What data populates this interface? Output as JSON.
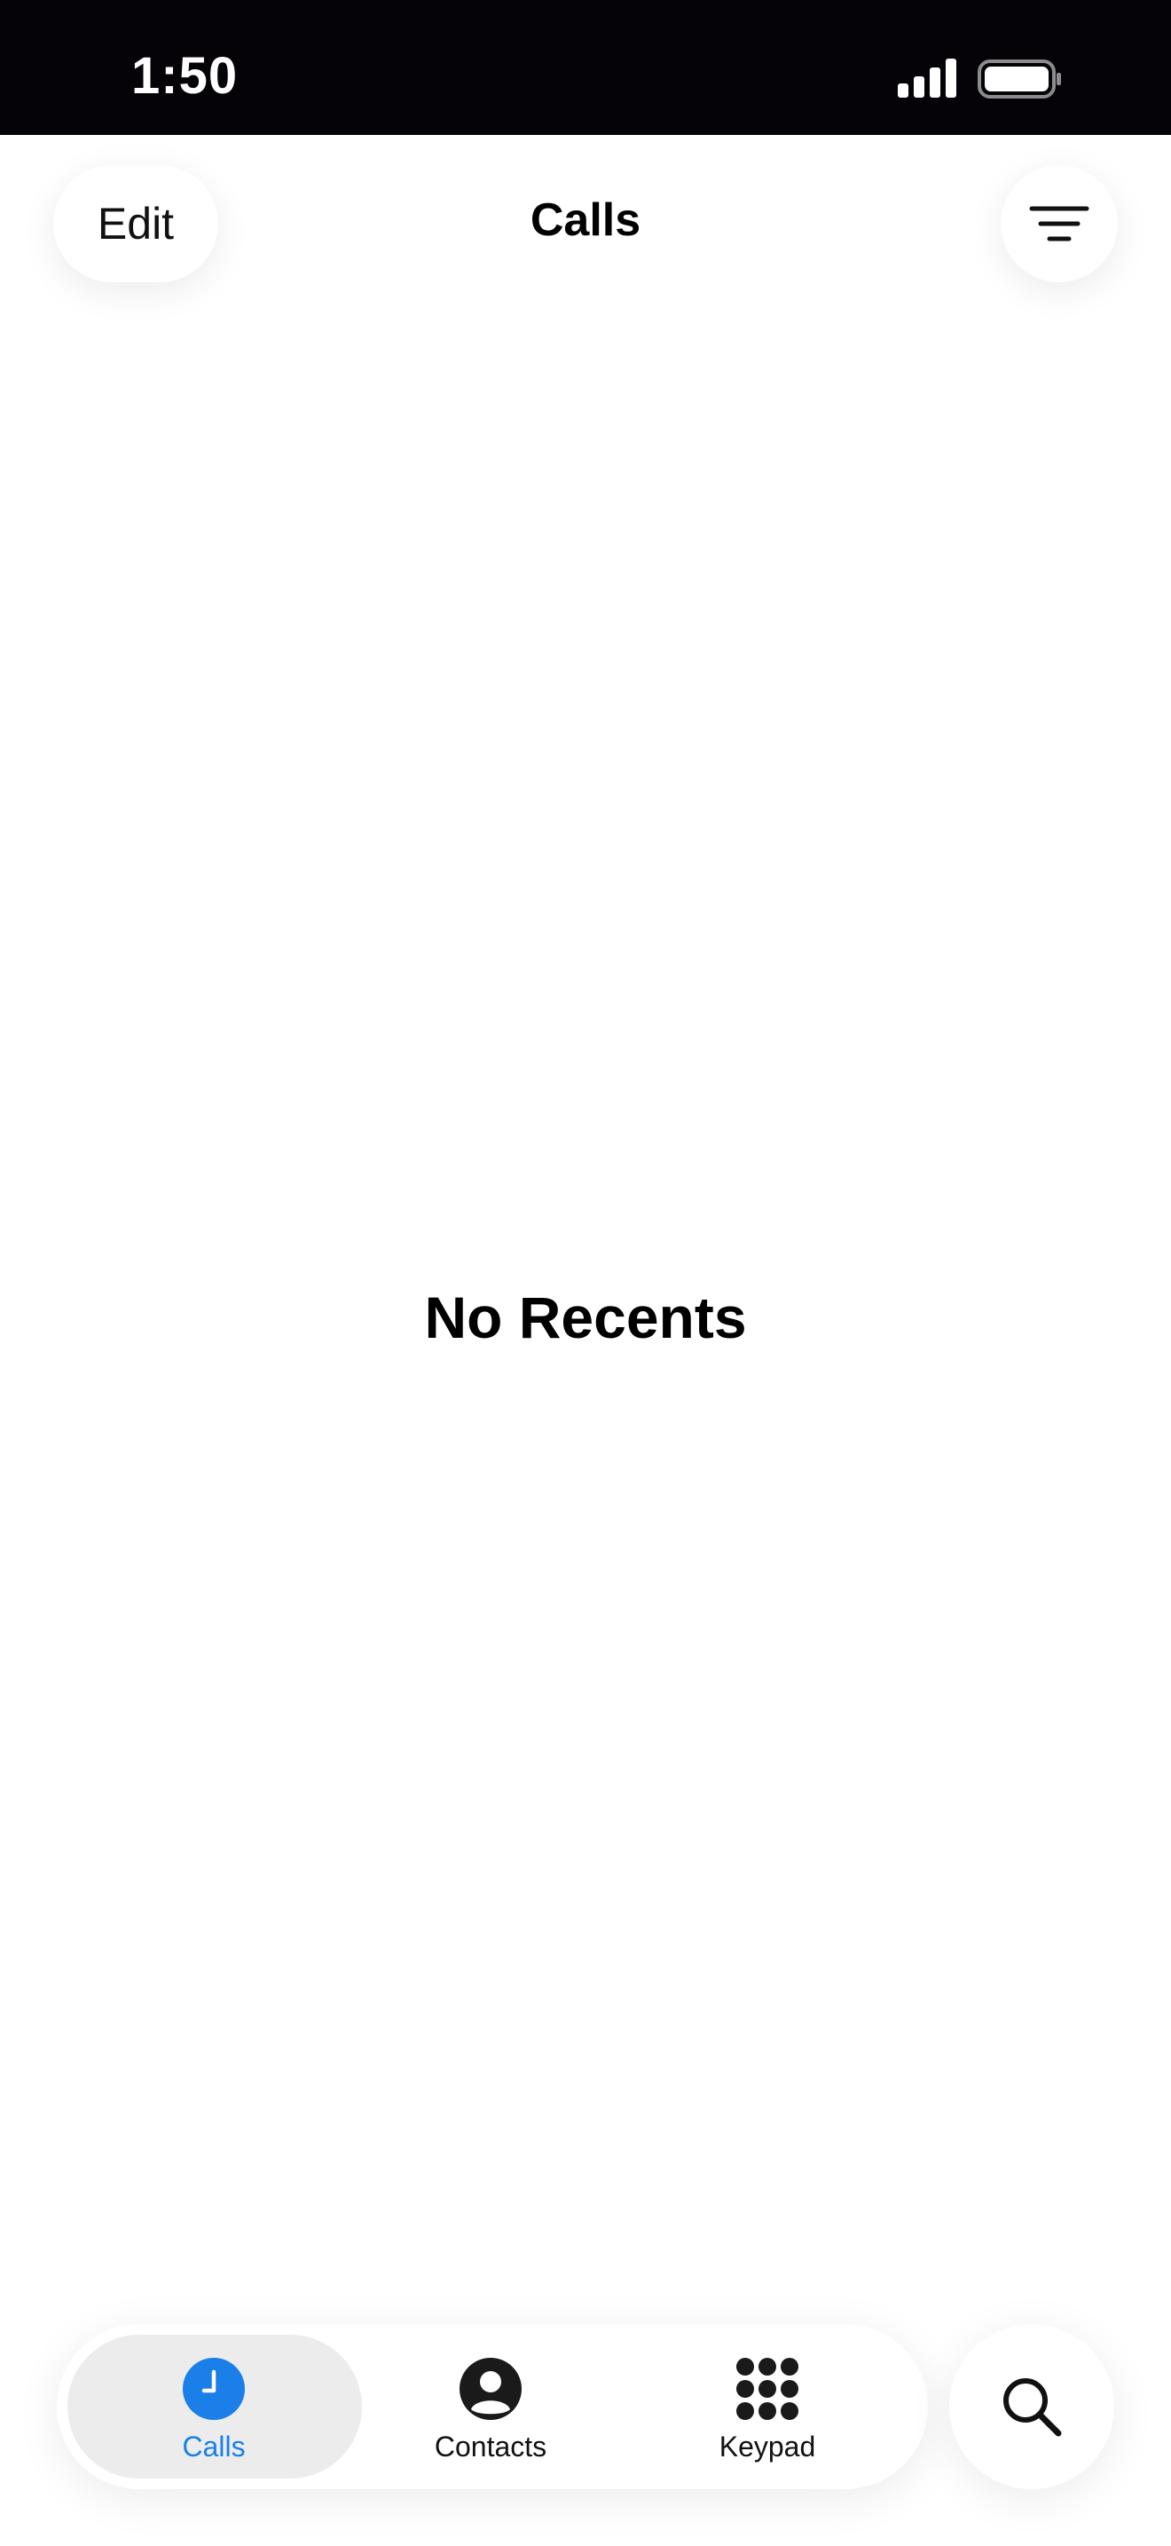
{
  "status_bar": {
    "time": "1:50",
    "signal_icon": "cellular-signal-icon",
    "battery_icon": "battery-full-icon"
  },
  "nav": {
    "edit_label": "Edit",
    "title": "Calls",
    "filter_icon": "filter-lines-icon"
  },
  "main": {
    "empty_state": "No Recents"
  },
  "tab_bar": {
    "tabs": [
      {
        "label": "Calls",
        "icon": "clock-icon",
        "selected": true
      },
      {
        "label": "Contacts",
        "icon": "person-circle-icon",
        "selected": false
      },
      {
        "label": "Keypad",
        "icon": "keypad-grid-icon",
        "selected": false
      }
    ],
    "search_icon": "search-icon"
  },
  "colors": {
    "accent": "#1a7fe8",
    "status_bar_bg": "#050308",
    "selected_pill": "#ececec"
  }
}
